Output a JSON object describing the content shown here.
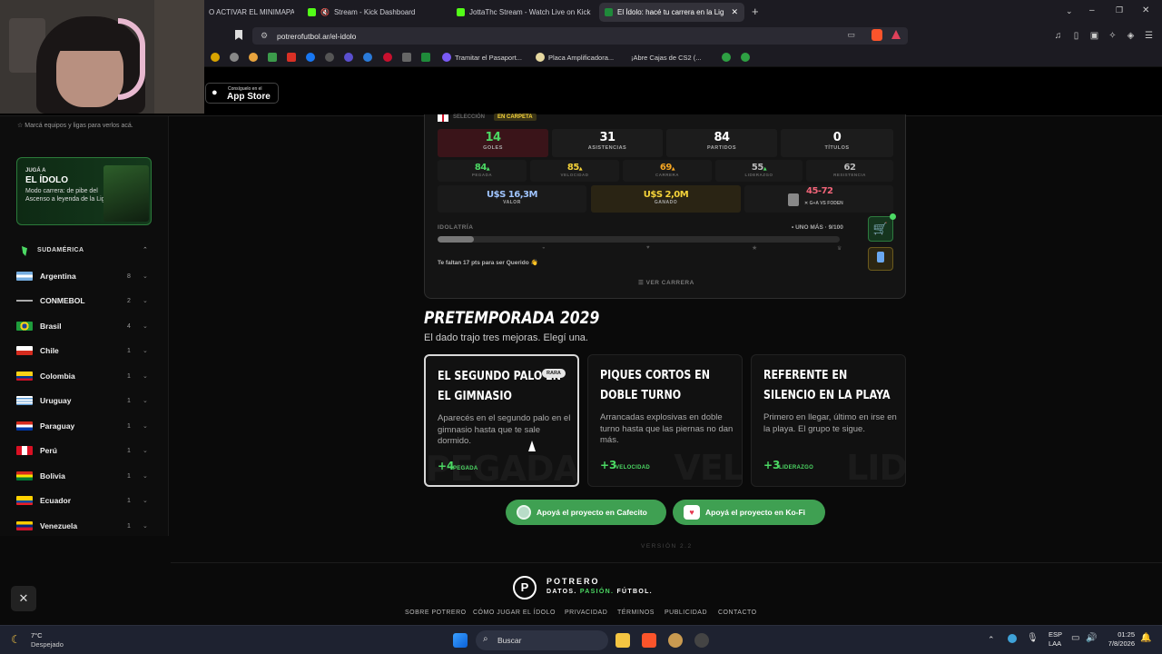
{
  "browser": {
    "tabs": [
      {
        "label": "O ACTIVAR EL MINIMAPA",
        "active": false
      },
      {
        "label": "Stream - Kick Dashboard",
        "active": false
      },
      {
        "label": "JottaThc Stream - Watch Live on Kick",
        "active": false
      },
      {
        "label": "El Ídolo: hacé tu carrera en la Lig",
        "active": true
      }
    ],
    "new_tab": "+",
    "url": "potrerofutbol.ar/el-idolo",
    "bookmarks": [
      "Tramitar el Pasaport...",
      "Placa Amplificadora...",
      "¡Abre Cajas de CS2 (..."
    ]
  },
  "site": {
    "appstore_small": "Consíguelo en el",
    "appstore_big": "App Store"
  },
  "sidebar": {
    "fav_hint": "Marcá equipos y ligas para verlos acá.",
    "promo": {
      "kicker": "JUGÁ A",
      "title": "EL ÍDOLO",
      "text": "Modo carrera: de pibe del Ascenso a leyenda de la Liga"
    },
    "region": "SUDAMÉRICA",
    "countries": [
      {
        "name": "Argentina",
        "count": "8"
      },
      {
        "name": "CONMEBOL",
        "count": "2"
      },
      {
        "name": "Brasil",
        "count": "4"
      },
      {
        "name": "Chile",
        "count": "1"
      },
      {
        "name": "Colombia",
        "count": "1"
      },
      {
        "name": "Uruguay",
        "count": "1"
      },
      {
        "name": "Paraguay",
        "count": "1"
      },
      {
        "name": "Perú",
        "count": "1"
      },
      {
        "name": "Bolivia",
        "count": "1"
      },
      {
        "name": "Ecuador",
        "count": "1"
      },
      {
        "name": "Venezuela",
        "count": "1"
      }
    ]
  },
  "career": {
    "seleccion_label": "SELECCIÓN",
    "status_badge": "EN CARPETA",
    "stats": [
      {
        "value": "14",
        "label": "GOLES"
      },
      {
        "value": "31",
        "label": "ASISTENCIAS"
      },
      {
        "value": "84",
        "label": "PARTIDOS"
      },
      {
        "value": "0",
        "label": "TÍTULOS"
      }
    ],
    "attrs": [
      {
        "value": "84",
        "label": "PEGADA",
        "color": "#4cd964",
        "up": "▲"
      },
      {
        "value": "85",
        "label": "VELOCIDAD",
        "color": "#f5d33a",
        "up": "▲"
      },
      {
        "value": "69",
        "label": "CARRERA",
        "color": "#f5a623",
        "up": "▲"
      },
      {
        "value": "55",
        "label": "LIDERAZGO",
        "color": "#bbbbbb",
        "up": "▲"
      },
      {
        "value": "62",
        "label": "RESISTENCIA",
        "color": "#bbbbbb",
        "up": ""
      }
    ],
    "valor": {
      "value": "U$S 16,3M",
      "label": "VALOR"
    },
    "ganado": {
      "value": "U$S 2,0M",
      "label": "GANADO"
    },
    "duel": {
      "value": "45-72",
      "label": "G+A VS FODEN"
    },
    "idolatria_label": "IDOLATRÍA",
    "idolatria_status": "UNO MÁS · 9/100",
    "idolatria_progress": 0.09,
    "hint": "Te faltan 17 pts para ser Querido",
    "ver_carrera": "VER CARRERA"
  },
  "season": {
    "title": "PRETEMPORADA 2029",
    "subtitle": "El dado trajo tres mejoras. Elegí una.",
    "choices": [
      {
        "title": "EL SEGUNDO PALO EN EL GIMNASIO",
        "badge": "RARA",
        "desc": "Aparecés en el segundo palo en el gimnasio hasta que te sale dormido.",
        "gain": "+4",
        "gain_label": "PEGADA",
        "watermark": "PEGADA"
      },
      {
        "title": "PIQUES CORTOS EN DOBLE TURNO",
        "badge": "",
        "desc": "Arrancadas explosivas en doble turno hasta que las piernas no dan más.",
        "gain": "+3",
        "gain_label": "VELOCIDAD",
        "watermark": "VEL"
      },
      {
        "title": "REFERENTE EN SILENCIO EN LA PLAYA",
        "badge": "",
        "desc": "Primero en llegar, último en irse en la playa. El grupo te sigue.",
        "gain": "+3",
        "gain_label": "LIDERAZGO",
        "watermark": "LID"
      }
    ]
  },
  "support": {
    "cafecito": "Apoyá el proyecto en Cafecito",
    "kofi": "Apoyá el proyecto en Ko-Fi"
  },
  "version": "VERSIÓN 2.2",
  "footer": {
    "brand": "POTRERO",
    "tagline_1": "DATOS.",
    "tagline_2": "PASIÓN.",
    "tagline_3": "FÚTBOL.",
    "links": [
      "SOBRE POTRERO",
      "CÓMO JUGAR EL ÍDOLO",
      "PRIVACIDAD",
      "TÉRMINOS",
      "PUBLICIDAD",
      "CONTACTO"
    ]
  },
  "taskbar": {
    "temp": "7°C",
    "weather": "Despejado",
    "search": "Buscar",
    "lang1": "ESP",
    "lang2": "LAA",
    "time": "01:25",
    "date": "7/8/2026"
  },
  "colors": {
    "accent": "#4cd964",
    "button": "#3fa052",
    "gold": "#f5d33a"
  }
}
